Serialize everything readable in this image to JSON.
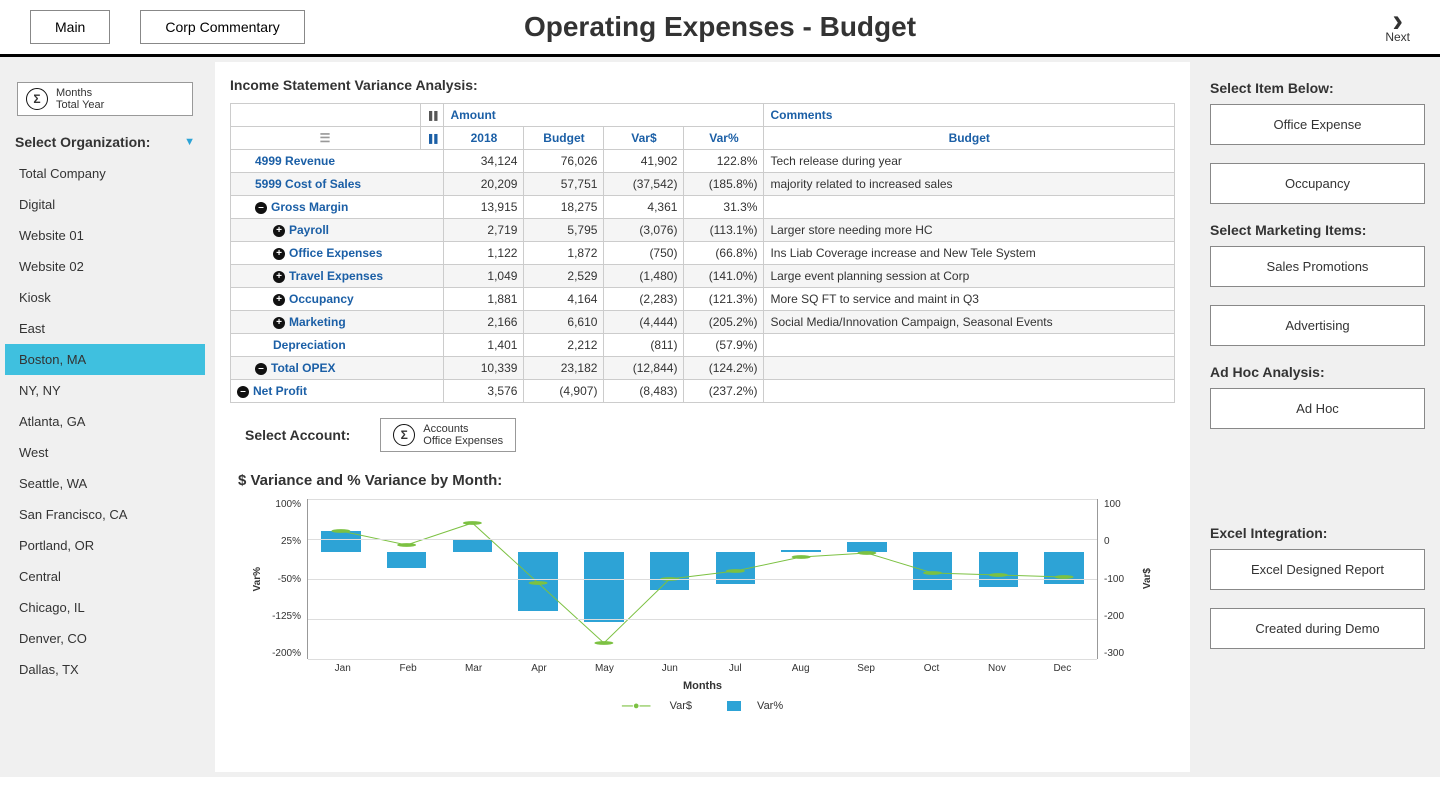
{
  "header": {
    "main_btn": "Main",
    "commentary_btn": "Corp Commentary",
    "title": "Operating Expenses - Budget",
    "next": "Next"
  },
  "period": {
    "l1": "Months",
    "l2": "Total Year"
  },
  "org_header": "Select Organization:",
  "orgs": [
    "Total Company",
    "Digital",
    "Website 01",
    "Website 02",
    "Kiosk",
    "East",
    "Boston, MA",
    "NY, NY",
    "Atlanta, GA",
    "West",
    "Seattle, WA",
    "San Francisco, CA",
    "Portland, OR",
    "Central",
    "Chicago, IL",
    "Denver, CO",
    "Dallas, TX"
  ],
  "org_active": 6,
  "variance_title": "Income Statement Variance Analysis:",
  "col_headers": {
    "amount": "Amount",
    "comments": "Comments",
    "y": "2018",
    "b": "Budget",
    "vd": "Var$",
    "vp": "Var%",
    "bc": "Budget"
  },
  "rows": [
    {
      "label": "4999 Revenue",
      "indent": 1,
      "icon": "",
      "y": "34,124",
      "b": "76,026",
      "vd": "41,902",
      "vp": "122.8%",
      "c": "Tech release during year",
      "alt": false
    },
    {
      "label": "5999 Cost of Sales",
      "indent": 1,
      "icon": "",
      "y": "20,209",
      "b": "57,751",
      "vd": "(37,542)",
      "vp": "(185.8%)",
      "c": "majority related to increased sales",
      "alt": true
    },
    {
      "label": "Gross Margin",
      "indent": 1,
      "icon": "–",
      "y": "13,915",
      "b": "18,275",
      "vd": "4,361",
      "vp": "31.3%",
      "c": "",
      "alt": false
    },
    {
      "label": "Payroll",
      "indent": 2,
      "icon": "+",
      "y": "2,719",
      "b": "5,795",
      "vd": "(3,076)",
      "vp": "(113.1%)",
      "c": "Larger store needing more HC",
      "alt": true
    },
    {
      "label": "Office Expenses",
      "indent": 2,
      "icon": "+",
      "y": "1,122",
      "b": "1,872",
      "vd": "(750)",
      "vp": "(66.8%)",
      "c": "Ins Liab Coverage increase and New Tele System",
      "alt": false
    },
    {
      "label": "Travel Expenses",
      "indent": 2,
      "icon": "+",
      "y": "1,049",
      "b": "2,529",
      "vd": "(1,480)",
      "vp": "(141.0%)",
      "c": "Large event planning session at Corp",
      "alt": true
    },
    {
      "label": "Occupancy",
      "indent": 2,
      "icon": "+",
      "y": "1,881",
      "b": "4,164",
      "vd": "(2,283)",
      "vp": "(121.3%)",
      "c": "More SQ FT to service and maint in Q3",
      "alt": false
    },
    {
      "label": "Marketing",
      "indent": 2,
      "icon": "+",
      "y": "2,166",
      "b": "6,610",
      "vd": "(4,444)",
      "vp": "(205.2%)",
      "c": "Social Media/Innovation Campaign, Seasonal Events",
      "alt": true
    },
    {
      "label": "Depreciation",
      "indent": 2,
      "icon": "",
      "y": "1,401",
      "b": "2,212",
      "vd": "(811)",
      "vp": "(57.9%)",
      "c": "",
      "alt": false
    },
    {
      "label": "Total OPEX",
      "indent": 1,
      "icon": "–",
      "y": "10,339",
      "b": "23,182",
      "vd": "(12,844)",
      "vp": "(124.2%)",
      "c": "",
      "alt": true
    },
    {
      "label": "Net Profit",
      "indent": 0,
      "icon": "–",
      "y": "3,576",
      "b": "(4,907)",
      "vd": "(8,483)",
      "vp": "(237.2%)",
      "c": "",
      "alt": false
    }
  ],
  "account": {
    "label": "Select Account:",
    "l1": "Accounts",
    "l2": "Office Expenses"
  },
  "chart": {
    "title": "$ Variance and % Variance by Month:",
    "xlabel": "Months",
    "leg1": "Var$",
    "leg2": "Var%",
    "yl_label": "Var%",
    "yr_label": "Var$"
  },
  "chart_data": {
    "type": "combo",
    "categories": [
      "Jan",
      "Feb",
      "Mar",
      "Apr",
      "May",
      "Jun",
      "Jul",
      "Aug",
      "Sep",
      "Oct",
      "Nov",
      "Dec"
    ],
    "series": [
      {
        "name": "Var%",
        "type": "bar",
        "yaxis": "left",
        "values": [
          40,
          -30,
          25,
          -110,
          -130,
          -70,
          -60,
          5,
          20,
          -70,
          -65,
          -60
        ]
      },
      {
        "name": "Var$",
        "type": "line",
        "yaxis": "right",
        "values": [
          20,
          -15,
          40,
          -110,
          -260,
          -100,
          -80,
          -45,
          -35,
          -85,
          -90,
          -95
        ]
      }
    ],
    "yl_ticks": [
      "100%",
      "25%",
      "-50%",
      "-125%",
      "-200%"
    ],
    "yr_ticks": [
      "100",
      "0",
      "-100",
      "-200",
      "-300"
    ],
    "yl_range": [
      -200,
      100
    ],
    "yr_range": [
      -300,
      100
    ]
  },
  "right": {
    "h1": "Select Item Below:",
    "b1": "Office Expense",
    "b2": "Occupancy",
    "h2": "Select Marketing Items:",
    "b3": "Sales Promotions",
    "b4": "Advertising",
    "h3": "Ad Hoc Analysis:",
    "b5": "Ad Hoc",
    "h4": "Excel Integration:",
    "b6": "Excel Designed Report",
    "b7": "Created during Demo"
  }
}
